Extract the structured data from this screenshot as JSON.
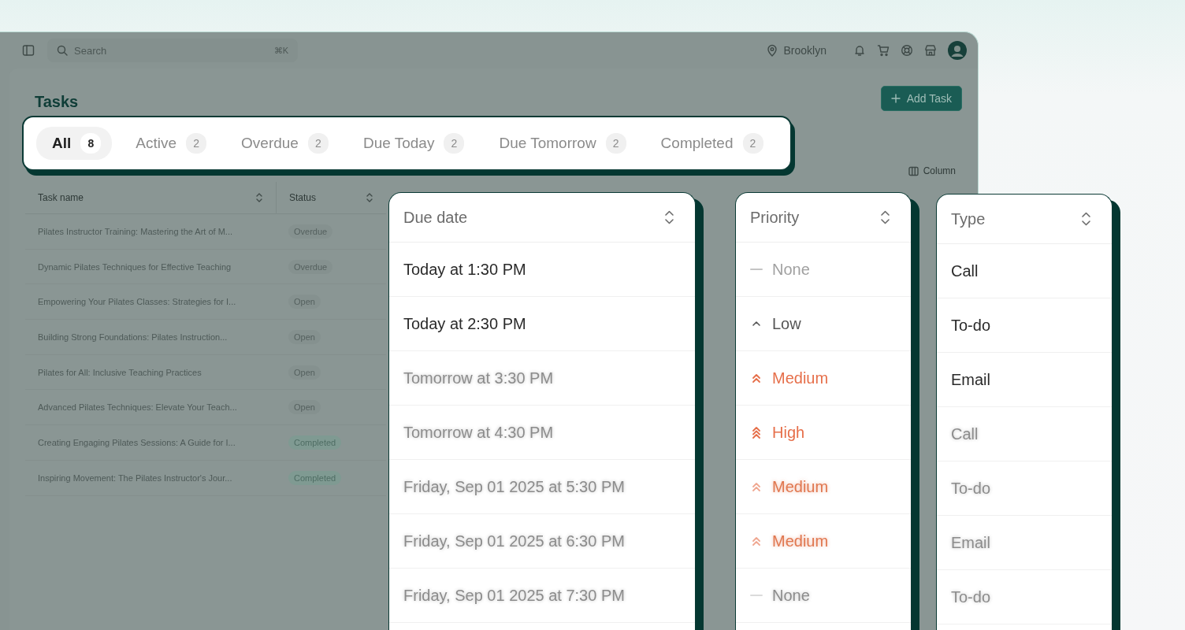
{
  "topbar": {
    "search": {
      "placeholder": "Search",
      "shortcut": "⌘K"
    },
    "location": "Brooklyn"
  },
  "page": {
    "title": "Tasks",
    "add_button": "Add Task",
    "column_button": "Column"
  },
  "tabs": [
    {
      "label": "All",
      "count": "8",
      "selected": true
    },
    {
      "label": "Active",
      "count": "2",
      "selected": false
    },
    {
      "label": "Overdue",
      "count": "2",
      "selected": false
    },
    {
      "label": "Due Today",
      "count": "2",
      "selected": false
    },
    {
      "label": "Due Tomorrow",
      "count": "2",
      "selected": false
    },
    {
      "label": "Completed",
      "count": "2",
      "selected": false
    }
  ],
  "table": {
    "columns": [
      "Task name",
      "Status"
    ],
    "rows": [
      {
        "name": "Pilates Instructor Training: Mastering the Art of M...",
        "status": "Overdue",
        "kind": "overdue"
      },
      {
        "name": "Dynamic Pilates Techniques for Effective Teaching",
        "status": "Overdue",
        "kind": "overdue"
      },
      {
        "name": "Empowering Your Pilates Classes: Strategies for I...",
        "status": "Open",
        "kind": "open"
      },
      {
        "name": "Building Strong Foundations: Pilates Instruction...",
        "status": "Open",
        "kind": "open"
      },
      {
        "name": "Pilates for All: Inclusive Teaching Practices",
        "status": "Open",
        "kind": "open"
      },
      {
        "name": "Advanced Pilates Techniques: Elevate Your Teach...",
        "status": "Open",
        "kind": "open"
      },
      {
        "name": "Creating Engaging Pilates Sessions: A Guide for I...",
        "status": "Completed",
        "kind": "completed"
      },
      {
        "name": "Inspiring Movement: The Pilates Instructor's Jour...",
        "status": "Completed",
        "kind": "completed"
      }
    ]
  },
  "due_date_card": {
    "header": "Due date",
    "rows": [
      {
        "text": "Today at 1:30 PM",
        "blurred": false
      },
      {
        "text": "Today at 2:30 PM",
        "blurred": false
      },
      {
        "text": "Tomorrow at 3:30 PM",
        "blurred": true
      },
      {
        "text": "Tomorrow at 4:30 PM",
        "blurred": true
      },
      {
        "text": "Friday, Sep 01 2025 at 5:30 PM",
        "blurred": true
      },
      {
        "text": "Friday, Sep 01 2025 at 6:30 PM",
        "blurred": true
      },
      {
        "text": "Friday, Sep 01 2025 at 7:30 PM",
        "blurred": true
      }
    ]
  },
  "priority_card": {
    "header": "Priority",
    "rows": [
      {
        "text": "None",
        "kind": "none",
        "blurred": false
      },
      {
        "text": "Low",
        "kind": "low",
        "blurred": false
      },
      {
        "text": "Medium",
        "kind": "medium",
        "blurred": false
      },
      {
        "text": "High",
        "kind": "high",
        "blurred": false
      },
      {
        "text": "Medium",
        "kind": "medium",
        "blurred": true
      },
      {
        "text": "Medium",
        "kind": "medium",
        "blurred": true
      },
      {
        "text": "None",
        "kind": "none",
        "blurred": true
      }
    ]
  },
  "type_card": {
    "header": "Type",
    "rows": [
      {
        "text": "Call",
        "blurred": false
      },
      {
        "text": "To-do",
        "blurred": false
      },
      {
        "text": "Email",
        "blurred": false
      },
      {
        "text": "Call",
        "blurred": true
      },
      {
        "text": "To-do",
        "blurred": true
      },
      {
        "text": "Email",
        "blurred": true
      },
      {
        "text": "To-do",
        "blurred": true
      }
    ]
  }
}
